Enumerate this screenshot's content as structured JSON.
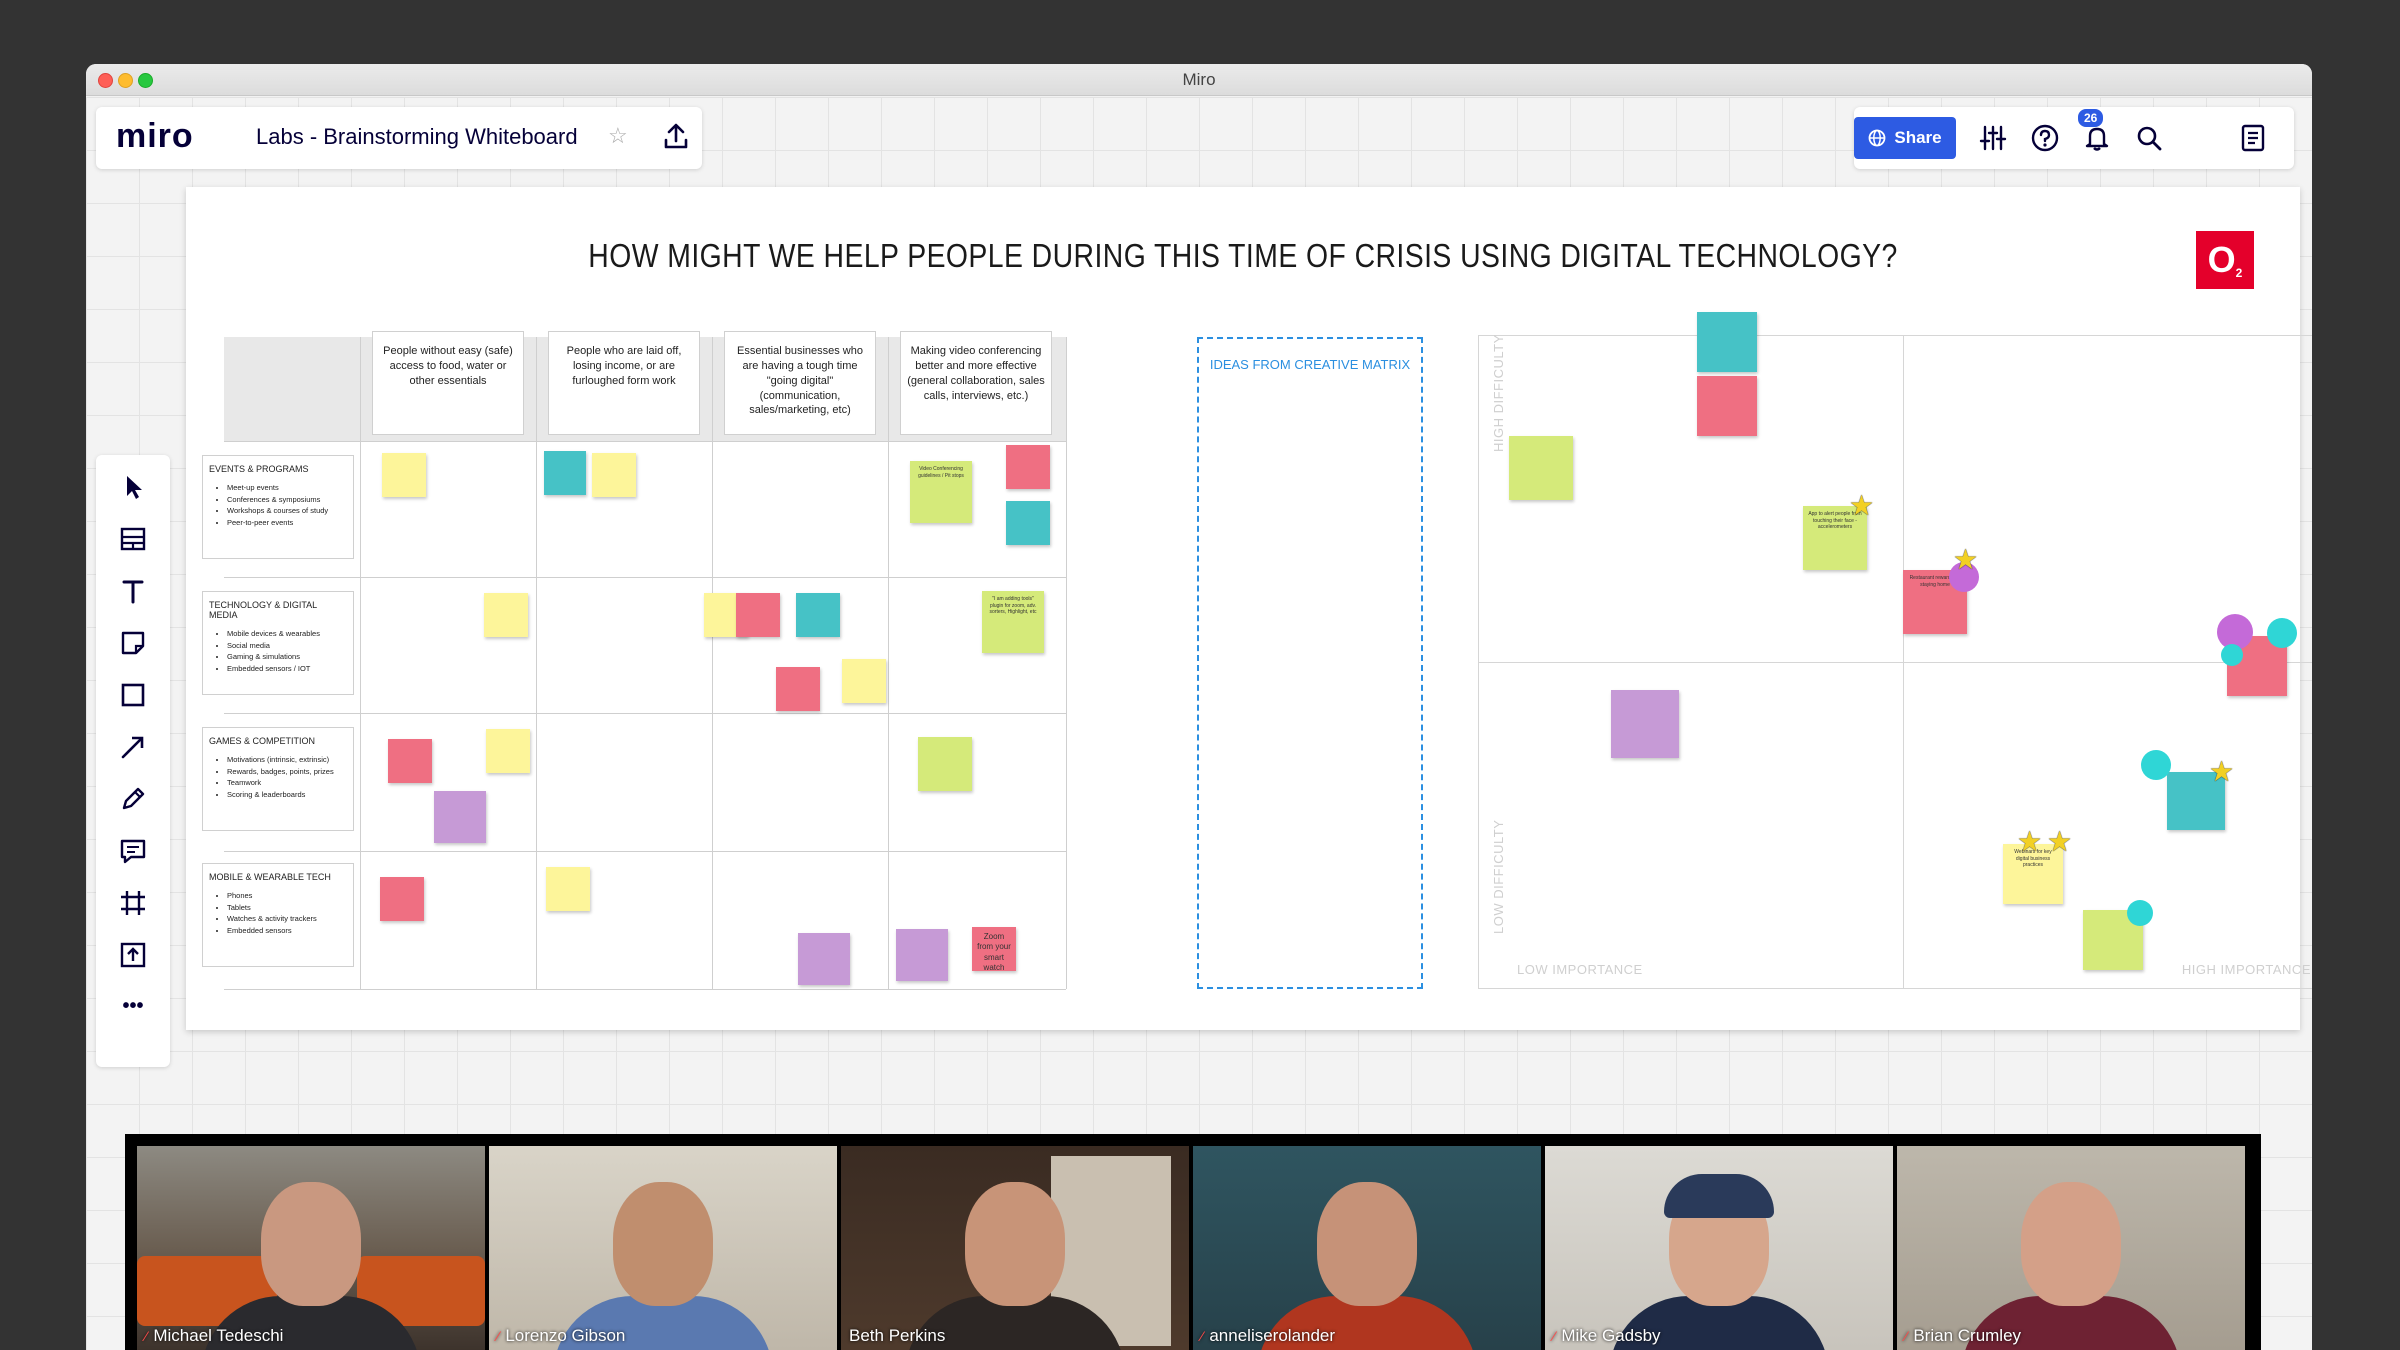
{
  "window": {
    "title": "Miro"
  },
  "header": {
    "logo": "miro",
    "board_title": "Labs - Brainstorming Whiteboard",
    "share_label": "Share",
    "help_badge": "26"
  },
  "toolbar": {
    "tools": [
      "cursor-icon",
      "templates-icon",
      "text-icon",
      "sticky-note-icon",
      "shape-icon",
      "arrow-icon",
      "pen-icon",
      "comment-icon",
      "frame-icon",
      "upload-icon",
      "more-icon"
    ],
    "more_label": "•••"
  },
  "board": {
    "title": "HOW MIGHT WE HELP PEOPLE DURING THIS TIME OF CRISIS USING DIGITAL TECHNOLOGY?",
    "logo_text": "O",
    "logo_sub": "2",
    "columns": [
      "People without easy (safe) access to food, water or other essentials",
      "People who are laid off, losing income, or are furloughed form work",
      "Essential businesses who are having a tough time \"going digital\" (communication, sales/marketing, etc)",
      "Making video conferencing better and more effective (general collaboration, sales calls, interviews, etc.)"
    ],
    "rows": [
      {
        "title": "EVENTS & PROGRAMS",
        "items": [
          "Meet-up events",
          "Conferences & symposiums",
          "Workshops & courses of study",
          "Peer-to-peer events"
        ]
      },
      {
        "title": "TECHNOLOGY & DIGITAL MEDIA",
        "items": [
          "Mobile devices & wearables",
          "Social media",
          "Gaming & simulations",
          "Embedded sensors / IOT"
        ]
      },
      {
        "title": "GAMES & COMPETITION",
        "items": [
          "Motivations (intrinsic, extrinsic)",
          "Rewards, badges, points, prizes",
          "Teamwork",
          "Scoring & leaderboards"
        ]
      },
      {
        "title": "MOBILE & WEARABLE TECH",
        "items": [
          "Phones",
          "Tablets",
          "Watches & activity trackers",
          "Embedded sensors"
        ]
      }
    ],
    "ideas_label": "IDEAS FROM CREATIVE MATRIX",
    "quadrant": {
      "high_difficulty": "HIGH DIFFICULTY",
      "low_difficulty": "LOW DIFFICULTY",
      "low_importance": "LOW IMPORTANCE",
      "high_importance": "HIGH IMPORTANCE"
    },
    "readable_stickies": {
      "video_conf": "Video Conferencing guidelines / Pit stops",
      "zoom": "Zoom from your smart watch",
      "plugin": "\"I am adding tools\" plugin for zoom, adv. sorters, Highlight, etc",
      "restaurant": "Restaurant rewards for staying home",
      "webinars": "Webinars for key digital business practices",
      "app": "App to alert people from touching their face - accelerometers"
    }
  },
  "participants": [
    {
      "name": "Michael Tedeschi",
      "muted": true
    },
    {
      "name": "Lorenzo Gibson",
      "muted": true
    },
    {
      "name": "Beth Perkins",
      "muted": false
    },
    {
      "name": "anneliserolander",
      "muted": true
    },
    {
      "name": "Mike Gadsby",
      "muted": true
    },
    {
      "name": "Brian Crumley",
      "muted": true
    }
  ]
}
